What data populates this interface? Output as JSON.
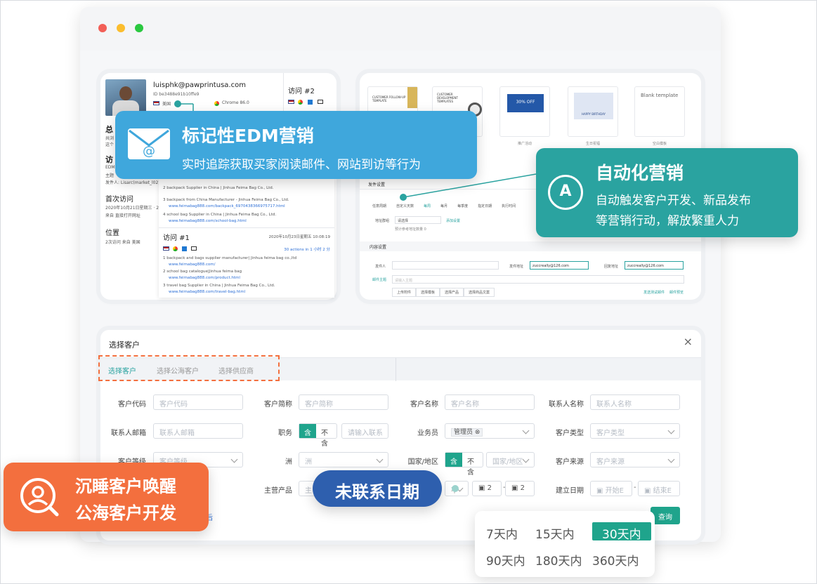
{
  "window": {
    "dots": [
      "#f25f57",
      "#fbbd2e",
      "#2ac840"
    ]
  },
  "profile": {
    "email": "luisphk@pawprintusa.com",
    "id_line": "ID be3488e91b10ffe9",
    "country": "美国",
    "browser": "Chrome 86.0",
    "summary_title": "总",
    "summary_lines": [
      "共浏",
      "这个"
    ],
    "visit_title": "访",
    "visit_lines": [
      "EDM",
      "主题",
      "发件人: Lisarc(market_l02)"
    ],
    "first_visit_title": "首次访问",
    "first_visit_date": "2020年10月21日星期三 · 2",
    "first_visit_source": "来自 直接打开网址",
    "location_title": "位置",
    "location_line": "2次访问 来自 美国"
  },
  "visit2": {
    "title": "访问 #2",
    "items": [
      {
        "n": "2",
        "text": "backpack Supplier in China | Jinhua Feima Bag Co., Ltd.",
        "url": ""
      },
      {
        "n": "3",
        "text": "backpack from China Manufacturer - Jinhua Feima Bag Co., Ltd.",
        "url": "www.feimabag888.com/backpack_6970438366975717.html"
      },
      {
        "n": "4",
        "text": "school bag Supplier in China | Jinhua Feima Bag Co., Ltd.",
        "url": "www.feimabag888.com/school-bag.html"
      }
    ]
  },
  "visit1": {
    "title": "访问 #1",
    "date": "2020年10月23日星期五 10:08:19",
    "actions": "30 actions in 1 小时 2 分",
    "items": [
      {
        "n": "1",
        "text": "backpack and bags supplier manufacturer| Jinhua feima bag co.,ltd",
        "url": "www.feimabag888.com/"
      },
      {
        "n": "2",
        "text": "school bag catalogue|Jinhua feima bag",
        "url": "www.feimabag888.com/product.html"
      },
      {
        "n": "3",
        "text": "travel bag Supplier in China | Jinhua Feima Bag Co., Ltd.",
        "url": "www.feimabag888.com/travel-bag.html"
      }
    ]
  },
  "edm_callout": {
    "title": "标记性EDM营销",
    "subtitle": "实时追踪获取买家阅读邮件、网站到访等行为"
  },
  "auto_callout": {
    "icon_letter": "A",
    "title": "自动化营销",
    "line1": "自动触发客户开发、新品发布",
    "line2": "等营销行动，解放繁重人力"
  },
  "templates": [
    {
      "title": "CUSTOMER FOLLOW-UP TEMPLATE",
      "caption": ""
    },
    {
      "title": "CUSTOMER DEVELOPMENT TEMPLATES",
      "caption": ""
    },
    {
      "title": "30% OFF",
      "caption": "推广活动"
    },
    {
      "title": "HAPPY BIRTHDAY",
      "caption": "生日祝福"
    },
    {
      "title": "Blank template",
      "caption": "空白模板"
    }
  ],
  "email_form": {
    "send_settings": "发件设置",
    "radio_labels": [
      "任意周期",
      "自定义天数",
      "每周",
      "每月",
      "每季度",
      "指定日期",
      "执行时间"
    ],
    "recipient_label": "地址群组",
    "recipient_value": "请选择",
    "add_label": "添加设置",
    "count_note": "预计参考地址数量 0",
    "content_settings": "内容设置",
    "sender_label": "发件人",
    "from_label": "发件地址",
    "from_value": "zuccreally@126.com",
    "reply_label": "回复地址",
    "reply_value": "zuccreally@126.com",
    "subject_label": "邮件主题",
    "subject_placeholder": "请输入主题",
    "toolbar": [
      "上传附件",
      "选择模板",
      "选择产品",
      "选择商品文案"
    ],
    "links": [
      "发送测试邮件",
      "邮件预览"
    ]
  },
  "dialog": {
    "title": "选择客户",
    "close": "×",
    "tabs": [
      "选择客户",
      "选择公海客户",
      "选择供应商"
    ],
    "row1": [
      {
        "label": "客户代码",
        "placeholder": "客户代码"
      },
      {
        "label": "客户简称",
        "placeholder": "客户简称"
      },
      {
        "label": "客户名称",
        "placeholder": "客户名称"
      },
      {
        "label": "联系人名称",
        "placeholder": "联系人名称"
      }
    ],
    "row2": {
      "email_label": "联系人邮箱",
      "email_placeholder": "联系人邮箱",
      "role_label": "职务",
      "include": "含",
      "exclude": "不含",
      "role_placeholder": "请输入联系",
      "sales_label": "业务员",
      "sales_tag": "管理员",
      "type_label": "客户类型",
      "type_placeholder": "客户类型"
    },
    "row3": {
      "level_label": "客户等级",
      "level_placeholder": "客户等级",
      "continent_label": "洲",
      "continent_placeholder": "洲",
      "country_label": "国家/地区",
      "include": "含",
      "exclude": "不含",
      "country_placeholder": "国家/地区",
      "source_label": "客户来源",
      "source_placeholder": "客户来源"
    },
    "row4": {
      "product_label": "主营产品",
      "product_placeholder": "主",
      "day_sel": "不",
      "day_from": "2",
      "day_to": "2",
      "created_label": "建立日期",
      "start_placeholder": "开始E",
      "end_placeholder": "结束E"
    },
    "query": "查询",
    "link_fragment": "后"
  },
  "wake_callout": {
    "line1": "沉睡客户唤醒",
    "line2": "公海客户开发"
  },
  "uncontacted": {
    "label": "未联系日期"
  },
  "day_options": [
    {
      "label": "7天内",
      "selected": false
    },
    {
      "label": "15天内",
      "selected": false
    },
    {
      "label": "30天内",
      "selected": true
    },
    {
      "label": "90天内",
      "selected": false
    },
    {
      "label": "180天内",
      "selected": false
    },
    {
      "label": "360天内",
      "selected": false
    }
  ],
  "colors": {
    "teal": "#2aa3a0",
    "edm_blue": "#3fa7dc",
    "orange": "#f36f3e",
    "navy": "#2e5fae",
    "select_green": "#1fa48c"
  }
}
